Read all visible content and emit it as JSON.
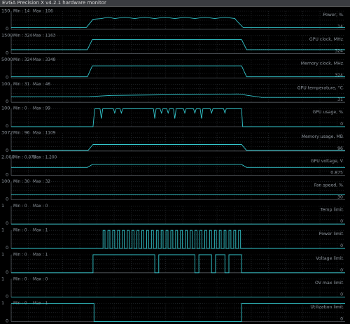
{
  "window": {
    "title": "EVGA Precision X v4.2.1 hardware monitor"
  },
  "colors": {
    "background": "#000000",
    "grid": "#2e3338",
    "trace": "#33c6cc",
    "text": "#8e969e",
    "titlebar": "#3a3c40"
  },
  "panels": [
    {
      "name": "Power, %",
      "min_label": "Min : 14",
      "max_label": "Max : 106",
      "ymax_label": "150",
      "ymin_label": "0",
      "current": "14",
      "low": 14,
      "high": 106,
      "axis_max": 150,
      "shape": "power"
    },
    {
      "name": "GPU clock, MHz",
      "min_label": "Min : 324",
      "max_label": "Max : 1163",
      "ymax_label": "1500",
      "ymin_label": "0",
      "current": "324",
      "low": 324,
      "high": 1163,
      "axis_max": 1500,
      "shape": "clock"
    },
    {
      "name": "Memory clock, MHz",
      "min_label": "Min : 324",
      "max_label": "Max : 3348",
      "ymax_label": "5000",
      "ymin_label": "0",
      "current": "324",
      "low": 324,
      "high": 3348,
      "axis_max": 5000,
      "shape": "clock"
    },
    {
      "name": "GPU temperature, °C",
      "min_label": "Min : 31",
      "max_label": "Max : 46",
      "ymax_label": "100",
      "ymin_label": "0",
      "current": "31",
      "low": 31,
      "high": 46,
      "axis_max": 100,
      "shape": "temp"
    },
    {
      "name": "GPU usage, %",
      "min_label": "Min : 0",
      "max_label": "Max : 99",
      "ymax_label": "100",
      "ymin_label": "0",
      "current": "0",
      "low": 0,
      "high": 99,
      "axis_max": 100,
      "shape": "usage"
    },
    {
      "name": "Memory usage, MB",
      "min_label": "Min : 96",
      "max_label": "Max : 1109",
      "ymax_label": "3072",
      "ymin_label": "0",
      "current": "96",
      "low": 96,
      "high": 1109,
      "axis_max": 3072,
      "shape": "memory"
    },
    {
      "name": "GPU voltage, V",
      "min_label": "Min : 0.875",
      "max_label": "Max : 1.200",
      "ymax_label": "2.000",
      "ymin_label": "0",
      "current": "0.875",
      "low": 0.875,
      "high": 1.2,
      "axis_max": 2.0,
      "shape": "clock"
    },
    {
      "name": "Fan speed, %",
      "min_label": "Min : 30",
      "max_label": "Max : 32",
      "ymax_label": "100",
      "ymin_label": "0",
      "current": "30",
      "low": 30,
      "high": 31,
      "axis_max": 100,
      "shape": "flat"
    },
    {
      "name": "Temp limit",
      "min_label": "Min : 0",
      "max_label": "Max : 0",
      "ymax_label": "1",
      "ymin_label": "0",
      "current": "0",
      "low": 0,
      "high": 0,
      "axis_max": 1,
      "shape": "flat"
    },
    {
      "name": "Power limit",
      "min_label": "Min : 0",
      "max_label": "Max : 1",
      "ymax_label": "1",
      "ymin_label": "0",
      "current": "0",
      "low": 0,
      "high": 1,
      "axis_max": 1,
      "shape": "pulses"
    },
    {
      "name": "Voltage limit",
      "min_label": "Min : 0",
      "max_label": "Max : 1",
      "ymax_label": "1",
      "ymin_label": "0",
      "current": "0",
      "low": 0,
      "high": 1,
      "axis_max": 1,
      "shape": "vlimit"
    },
    {
      "name": "OV max limit",
      "min_label": "Min : 0",
      "max_label": "Max : 0",
      "ymax_label": "1",
      "ymin_label": "0",
      "current": "0",
      "low": 0,
      "high": 0,
      "axis_max": 1,
      "shape": "flat"
    },
    {
      "name": "Utilization limit",
      "min_label": "Min : 0",
      "max_label": "Max : 1",
      "ymax_label": "1",
      "ymin_label": "0",
      "current": "0",
      "low": 0,
      "high": 1,
      "axis_max": 1,
      "shape": "util"
    }
  ]
}
